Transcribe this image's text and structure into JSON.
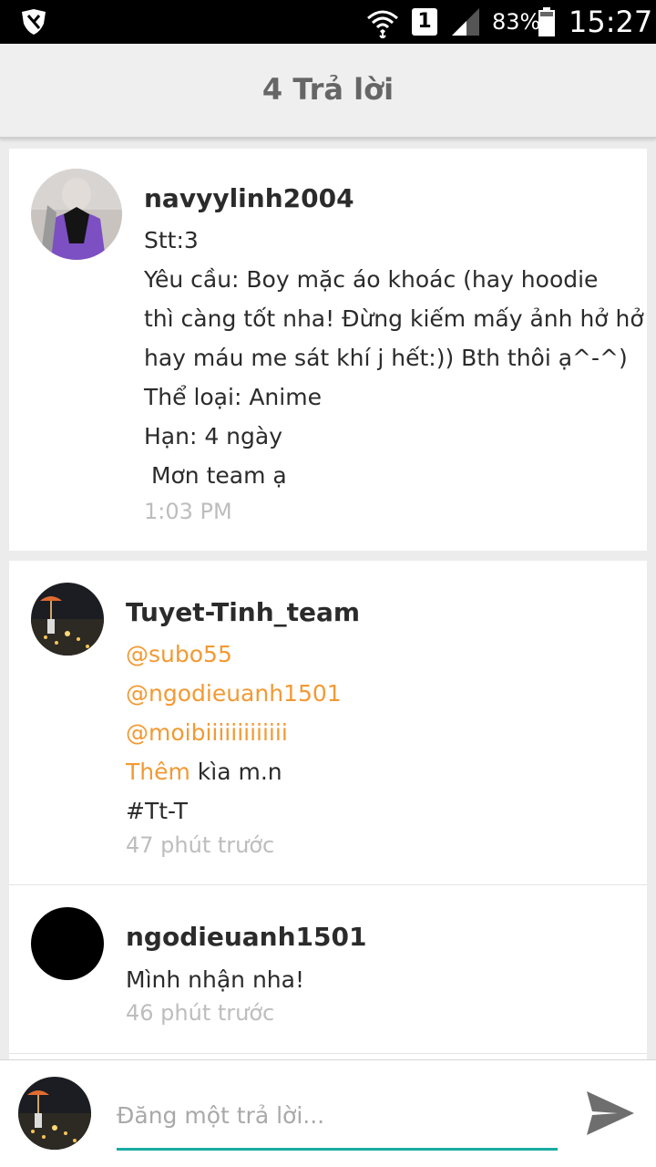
{
  "status_bar": {
    "sim_slot": "1",
    "battery_percent": "83%",
    "time": "15:27",
    "icons": [
      "shield-icon",
      "wifi-icon",
      "signal-icon",
      "battery-icon"
    ]
  },
  "header": {
    "title": "4 Trả lời"
  },
  "post": {
    "username": "navyylinh2004",
    "lines": [
      "Stt:3",
      "Yêu cầu: Boy mặc áo khoác (hay hoodie",
      "thì càng tốt nha! Đừng kiếm mấy ảnh hở hở",
      "hay máu me sát khí j hết:)) Bth thôi ạ^-^)",
      "Thể loại: Anime",
      "Hạn: 4 ngày",
      " Mơn team ạ"
    ],
    "time": "1:03 PM"
  },
  "replies": [
    {
      "username": "Tuyet-Tinh_team",
      "mentions": [
        "@subo55",
        "@ngodieuanh1501",
        "@moibiiiiiiiiiiiii"
      ],
      "highlight_word": "Thêm",
      "line_rest": " kìa m.n",
      "tag": "#Tt-T",
      "time": "47 phút trước"
    },
    {
      "username": "ngodieuanh1501",
      "text": "Mình nhận nha!",
      "time": "46 phút trước"
    }
  ],
  "compose": {
    "placeholder": "Đăng một trả lời...",
    "accent_color": "#1aaba3"
  },
  "colors": {
    "mention": "#f29a34",
    "timestamp": "#bdbdbd"
  }
}
